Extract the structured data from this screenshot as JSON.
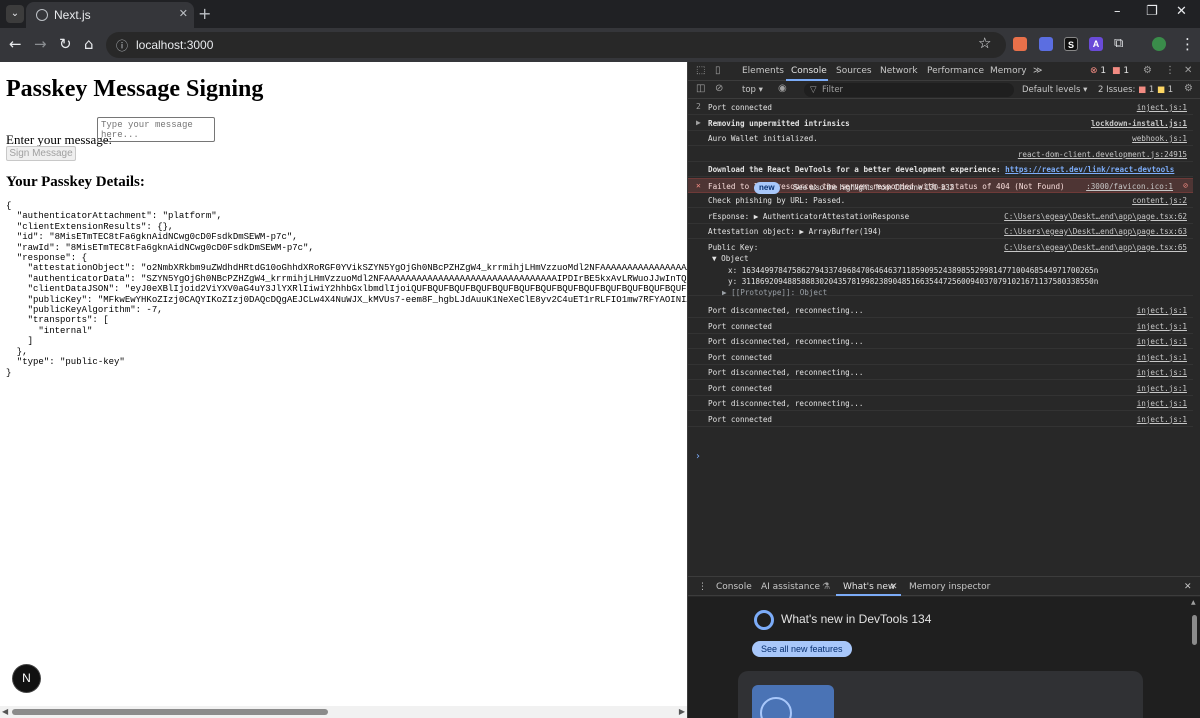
{
  "browser": {
    "tab_title": "Next.js",
    "tab_close": "✕",
    "new_tab": "+",
    "url": "localhost:3000",
    "controls": {
      "minimize": "–",
      "restore": "❐",
      "close": "✕"
    }
  },
  "page": {
    "title": "Passkey Message Signing",
    "message_label": "Enter your message:",
    "message_placeholder": "Type your message here...",
    "sign_button": "Sign Message",
    "details_title": "Your Passkey Details:",
    "json_lines": [
      "{",
      "  \"authenticatorAttachment\": \"platform\",",
      "  \"clientExtensionResults\": {},",
      "  \"id\": \"8MisETmTEC8tFa6gknAidNCwg0cD0FsdkDmSEWM-p7c\",",
      "  \"rawId\": \"8MisETmTEC8tFa6gknAidNCwg0cD0FsdkDmSEWM-p7c\",",
      "  \"response\": {",
      "    \"attestationObject\": \"o2NmbXRkbm9uZWdhdHRtdG10oGhhdXRoRGF0YVikSZYN5YgOjGh0NBcPZHZgW4_krrmihjLHmVzzuoMdl2NFAAAAAAAAAAAAAAAAAAAAAAAAA",
      "    \"authenticatorData\": \"SZYN5YgOjGh0NBcPZHZgW4_krrmihjLHmVzzuoMdl2NFAAAAAAAAAAAAAAAAAAAAAAAAAAAAAAAAIPDIrBE5kxAvLRWuoJJwInTQsINHA9BbHZA5kH",
      "    \"clientDataJSON\": \"eyJ0eXBlIjoid2ViYXV0aG4uY3JlYXRlIiwiY2hhbGxlbmdlIjoiQUFBQUFBQUFBQUFBQUFBQUFBQUFBQUFBQUFBQUFBQUFBQUFBQUFBQSIsI",
      "    \"publicKey\": \"MFkwEwYHKoZIzj0CAQYIKoZIzj0DAQcDQgAEJCLw4X4NuWJX_kMVUs7-eem8F_hgbLJdAuuK1NeXeClE8yv2C4uET1rRLFIO1mw7RFYAOINIA4lAbk3BDp",
      "    \"publicKeyAlgorithm\": -7,",
      "    \"transports\": [",
      "      \"internal\"",
      "    ]",
      "  },",
      "  \"type\": \"public-key\"",
      "}"
    ],
    "next_badge": "N"
  },
  "devtools": {
    "tabs": [
      "Elements",
      "Console",
      "Sources",
      "Network",
      "Performance",
      "Memory"
    ],
    "active_tab": "Console",
    "more_tabs": "≫",
    "error_count": "1",
    "warning_count": "1",
    "context": "top",
    "filter_placeholder": "Filter",
    "levels": "Default levels",
    "issues_label": "2 Issues:",
    "issues_err": "1",
    "issues_warn": "1",
    "console_rows": [
      {
        "lead": "2",
        "text": "Port connected",
        "source": "inject.js:1"
      },
      {
        "lead": "▶",
        "text": "Removing unpermitted intrinsics",
        "source": "lockdown-install.js:1",
        "bold": true
      },
      {
        "lead": "",
        "text": "Auro Wallet initialized.",
        "source": "webhook.js:1"
      },
      {
        "lead": "",
        "text": "",
        "source": "react-dom-client.development.js:24915"
      },
      {
        "lead": "",
        "text": "Download the React DevTools for a better development experience: ",
        "link": "https://react.dev/link/react-devtools",
        "bold": true
      },
      {
        "lead": "✕",
        "text": "Failed to load resource: the server responded with a status of 404 (Not Found)",
        "source": ":3000/favicon.ico:1",
        "error": true
      },
      {
        "lead": "",
        "text": "Check phishing by URL: Passed.",
        "source": "content.js:2"
      },
      {
        "lead": "",
        "text": "rEsponse:  ▶ AuthenticatorAttestationResponse",
        "source": "C:\\Users\\egeay\\Deskt…end\\app\\page.tsx:62"
      },
      {
        "lead": "",
        "text": "Attestation object:  ▶ ArrayBuffer(194)",
        "source": "C:\\Users\\egeay\\Deskt…end\\app\\page.tsx:63"
      },
      {
        "lead": "",
        "text": "Public Key:",
        "source": "C:\\Users\\egeay\\Deskt…end\\app\\page.tsx:65"
      }
    ],
    "object_label": "▼ Object",
    "object_x": "x: 16344997847586279433749684706464637118590952438985529981477100468544971700265n",
    "object_y": "y: 31186920948858883020435781998238904851663544725600940370791021671137580338550n",
    "object_proto": "▶ [[Prototype]]: Object",
    "port_rows": [
      {
        "text": "Port disconnected, reconnecting...",
        "source": "inject.js:1"
      },
      {
        "text": "Port connected",
        "source": "inject.js:1"
      },
      {
        "text": "Port disconnected, reconnecting...",
        "source": "inject.js:1"
      },
      {
        "text": "Port connected",
        "source": "inject.js:1"
      },
      {
        "text": "Port disconnected, reconnecting...",
        "source": "inject.js:1"
      },
      {
        "text": "Port connected",
        "source": "inject.js:1"
      },
      {
        "text": "Port disconnected, reconnecting...",
        "source": "inject.js:1"
      },
      {
        "text": "Port connected",
        "source": "inject.js:1"
      }
    ],
    "prompt": "›",
    "drawer_tabs": [
      "Console",
      "AI assistance",
      "What's new",
      "Memory inspector"
    ],
    "drawer_active": "What's new",
    "whatsnew_title": "What's new in DevTools 134",
    "see_all": "See all new features",
    "card_badge": "new",
    "card_text": "See also the highlights from Chrome 130-132"
  }
}
